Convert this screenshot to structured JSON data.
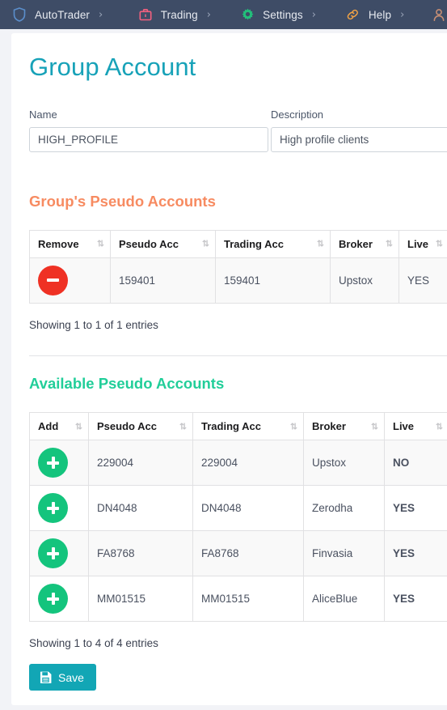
{
  "navbar": {
    "items": [
      {
        "label": "AutoTrader",
        "icon": "shield-icon",
        "icon_color": "#5b8ecb",
        "caret": "›"
      },
      {
        "label": "Trading",
        "icon": "briefcase-icon",
        "icon_color": "#f4607f",
        "caret": "›"
      },
      {
        "label": "Settings",
        "icon": "gear-icon",
        "icon_color": "#22c07a",
        "caret": "›"
      },
      {
        "label": "Help",
        "icon": "link-icon",
        "icon_color": "#f5a444",
        "caret": "›"
      }
    ],
    "user_icon": "user-icon",
    "user_icon_color": "#c78e74"
  },
  "page": {
    "title": "Group Account"
  },
  "form": {
    "name": {
      "label": "Name",
      "value": "HIGH_PROFILE",
      "placeholder": "Name"
    },
    "description": {
      "label": "Description",
      "value": "High profile clients",
      "placeholder": "Description"
    }
  },
  "group_section": {
    "title": "Group's Pseudo Accounts",
    "title_color": "#f78b61",
    "columns": [
      "Remove",
      "Pseudo Acc",
      "Trading Acc",
      "Broker",
      "Live"
    ],
    "rows": [
      {
        "action_icon": "minus-icon",
        "pseudo_acc": "159401",
        "trading_acc": "159401",
        "broker": "Upstox",
        "live": "YES",
        "live_state": "plain"
      }
    ],
    "entries_info": "Showing 1 to 1 of 1 entries"
  },
  "available_section": {
    "title": "Available Pseudo Accounts",
    "title_color": "#21ce99",
    "columns": [
      "Add",
      "Pseudo Acc",
      "Trading Acc",
      "Broker",
      "Live"
    ],
    "rows": [
      {
        "action_icon": "plus-icon",
        "pseudo_acc": "229004",
        "trading_acc": "229004",
        "broker": "Upstox",
        "live": "NO",
        "live_state": "no"
      },
      {
        "action_icon": "plus-icon",
        "pseudo_acc": "DN4048",
        "trading_acc": "DN4048",
        "broker": "Zerodha",
        "live": "YES",
        "live_state": "yes"
      },
      {
        "action_icon": "plus-icon",
        "pseudo_acc": "FA8768",
        "trading_acc": "FA8768",
        "broker": "Finvasia",
        "live": "YES",
        "live_state": "yes"
      },
      {
        "action_icon": "plus-icon",
        "pseudo_acc": "MM01515",
        "trading_acc": "MM01515",
        "broker": "AliceBlue",
        "live": "YES",
        "live_state": "yes"
      }
    ],
    "entries_info": "Showing 1 to 4 of 4 entries"
  },
  "save": {
    "label": "Save",
    "icon": "save-disk-icon",
    "color": "#12a6b5"
  },
  "theme": {
    "navbar_bg": "#3e4c66",
    "title_color": "#17a2b8",
    "page_bg": "#f2f3f7",
    "card_bg": "#ffffff",
    "remove_btn": "#ef3124",
    "add_btn": "#14c47d",
    "live_yes": "#21ce99",
    "live_no": "#ed2b2b"
  }
}
